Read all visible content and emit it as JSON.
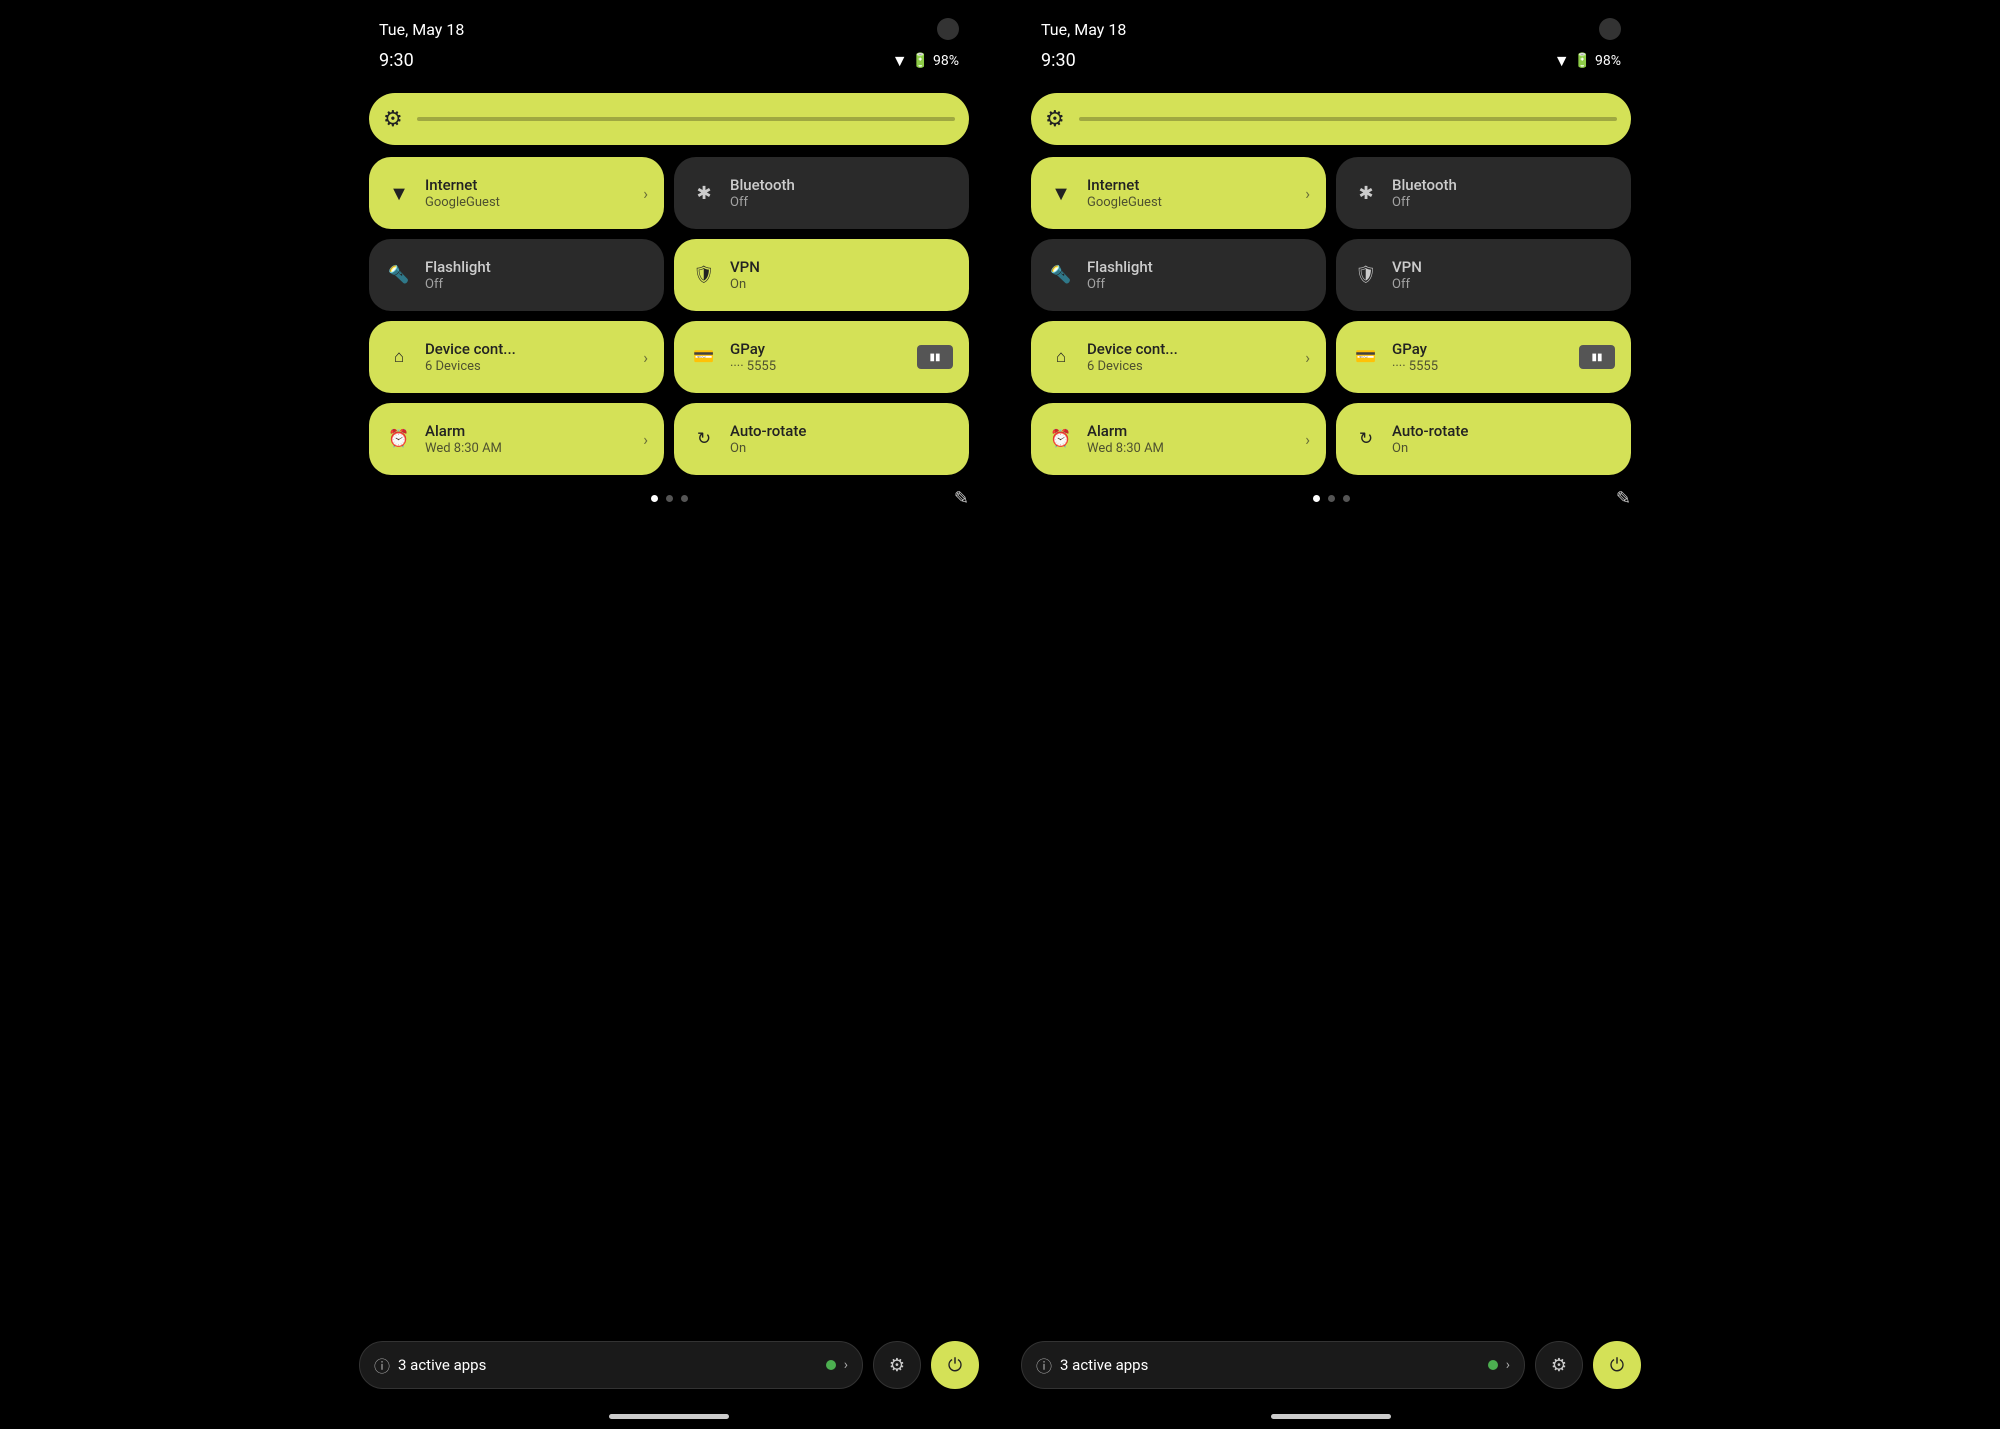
{
  "left": {
    "statusBar": {
      "date": "Tue, May 18",
      "time": "9:30",
      "wifi": "▾",
      "battery": "98%"
    },
    "brightness": {
      "icon": "⚙"
    },
    "tiles": [
      {
        "id": "internet",
        "title": "Internet",
        "subtitle": "GoogleGuest",
        "icon": "▼",
        "state": "active",
        "hasChevron": true
      },
      {
        "id": "bluetooth",
        "title": "Bluetooth",
        "subtitle": "Off",
        "icon": "✳",
        "state": "inactive",
        "hasChevron": false
      },
      {
        "id": "flashlight",
        "title": "Flashlight",
        "subtitle": "Off",
        "icon": "🔦",
        "state": "inactive",
        "hasChevron": false
      },
      {
        "id": "vpn",
        "title": "VPN",
        "subtitle": "On",
        "icon": "🛡",
        "state": "active",
        "hasChevron": false
      },
      {
        "id": "device-control",
        "title": "Device cont...",
        "subtitle": "6 Devices",
        "icon": "⌂",
        "state": "active",
        "hasChevron": true
      },
      {
        "id": "gpay",
        "title": "GPay",
        "subtitle": "···· 5555",
        "icon": "▬",
        "state": "active",
        "hasChevron": false,
        "hasCard": true
      },
      {
        "id": "alarm",
        "title": "Alarm",
        "subtitle": "Wed 8:30 AM",
        "icon": "⏰",
        "state": "active",
        "hasChevron": true
      },
      {
        "id": "autorotate",
        "title": "Auto-rotate",
        "subtitle": "On",
        "icon": "↻",
        "state": "active",
        "hasChevron": false
      }
    ],
    "pagination": {
      "dots": [
        true,
        false,
        false
      ]
    },
    "bottomBar": {
      "activeApps": "3 active apps",
      "settingsIcon": "⚙",
      "powerIcon": "⏻"
    }
  },
  "right": {
    "statusBar": {
      "date": "Tue, May 18",
      "time": "9:30",
      "wifi": "▾",
      "battery": "98%"
    },
    "brightness": {
      "icon": "⚙"
    },
    "tiles": [
      {
        "id": "internet",
        "title": "Internet",
        "subtitle": "GoogleGuest",
        "icon": "▼",
        "state": "active",
        "hasChevron": true
      },
      {
        "id": "bluetooth",
        "title": "Bluetooth",
        "subtitle": "Off",
        "icon": "✳",
        "state": "inactive",
        "hasChevron": false
      },
      {
        "id": "flashlight",
        "title": "Flashlight",
        "subtitle": "Off",
        "icon": "🔦",
        "state": "inactive",
        "hasChevron": false
      },
      {
        "id": "vpn",
        "title": "VPN",
        "subtitle": "Off",
        "icon": "🛡",
        "state": "inactive",
        "hasChevron": false
      },
      {
        "id": "device-control",
        "title": "Device cont...",
        "subtitle": "6 Devices",
        "icon": "⌂",
        "state": "active",
        "hasChevron": true
      },
      {
        "id": "gpay",
        "title": "GPay",
        "subtitle": "···· 5555",
        "icon": "▬",
        "state": "active",
        "hasChevron": false,
        "hasCard": true
      },
      {
        "id": "alarm",
        "title": "Alarm",
        "subtitle": "Wed 8:30 AM",
        "icon": "⏰",
        "state": "active",
        "hasChevron": true
      },
      {
        "id": "autorotate",
        "title": "Auto-rotate",
        "subtitle": "On",
        "icon": "↻",
        "state": "active",
        "hasChevron": false
      }
    ],
    "pagination": {
      "dots": [
        true,
        false,
        false
      ]
    },
    "bottomBar": {
      "activeApps": "3 active apps",
      "settingsIcon": "⚙",
      "powerIcon": "⏻"
    }
  },
  "icons": {
    "wifi": "▾",
    "battery": "▮",
    "pencil": "✎",
    "chevron": "›",
    "info": "ⓘ"
  }
}
